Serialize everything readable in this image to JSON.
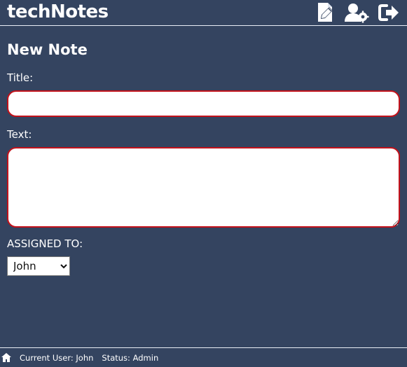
{
  "header": {
    "title": "techNotes",
    "actions": [
      {
        "icon": "new-note-icon"
      },
      {
        "icon": "user-settings-icon"
      },
      {
        "icon": "logout-icon"
      }
    ]
  },
  "form": {
    "heading": "New Note",
    "title_label": "Title:",
    "title_value": "",
    "text_label": "Text:",
    "text_value": "",
    "assigned_label": "ASSIGNED TO:",
    "assigned_value": "John",
    "assigned_options": [
      "John"
    ],
    "error_border_color": "#c2121b"
  },
  "footer": {
    "home_icon": "home-icon",
    "current_user": "Current User: John",
    "status": "Status: Admin"
  },
  "colors": {
    "background": "#344460",
    "text": "#ffffff",
    "divider": "#e9eef6"
  }
}
